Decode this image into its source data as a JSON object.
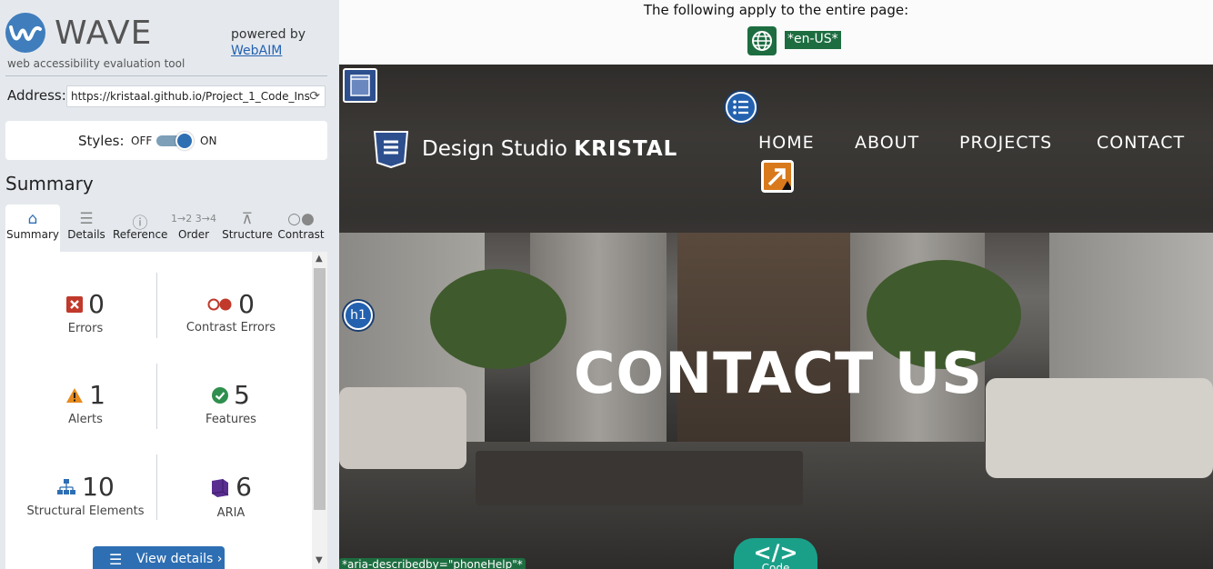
{
  "wave": {
    "title": "WAVE",
    "subtitle": "web accessibility evaluation tool",
    "powered_by": "powered by",
    "webaim_link": "WebAIM",
    "address_label": "Address:",
    "address_value": "https://kristaal.github.io/Project_1_Code_Ins",
    "styles_label": "Styles:",
    "styles_off": "OFF",
    "styles_on": "ON",
    "summary_heading": "Summary",
    "tabs": [
      {
        "label": "Summary",
        "icon": "home-icon"
      },
      {
        "label": "Details",
        "icon": "list-icon"
      },
      {
        "label": "Reference",
        "icon": "info-icon"
      },
      {
        "label": "Order",
        "icon": "order-icon"
      },
      {
        "label": "Structure",
        "icon": "structure-icon"
      },
      {
        "label": "Contrast",
        "icon": "contrast-icon"
      }
    ],
    "stats": {
      "errors": {
        "count": "0",
        "label": "Errors"
      },
      "contrast_errors": {
        "count": "0",
        "label": "Contrast Errors"
      },
      "alerts": {
        "count": "1",
        "label": "Alerts"
      },
      "features": {
        "count": "5",
        "label": "Features"
      },
      "structural": {
        "count": "10",
        "label": "Structural Elements"
      },
      "aria": {
        "count": "6",
        "label": "ARIA"
      }
    },
    "view_details": "View details ›",
    "colors": {
      "accent": "#2e6fb3",
      "error": "#c0392b",
      "alert": "#e68a1f",
      "feature": "#2f8f4e",
      "aria": "#5a2d91"
    }
  },
  "page": {
    "apply_text": "The following apply to the entire page:",
    "lang_badge": "*en-US*",
    "site_name_regular": "Design Studio ",
    "site_name_bold": "KRISTAL",
    "nav": [
      "HOME",
      "ABOUT",
      "PROJECTS",
      "CONTACT"
    ],
    "hero_title": "CONTACT US",
    "h1_badge": "h1",
    "aria_describedby": "*aria-describedby=\"phoneHelp\"*",
    "code_label": "Code",
    "code_icon": "</>"
  }
}
